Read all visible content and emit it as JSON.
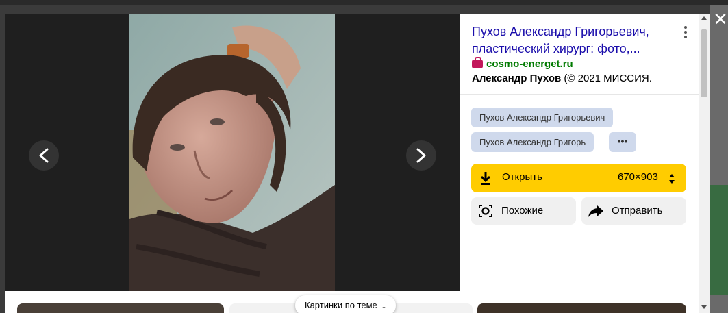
{
  "viewer": {
    "prev_icon": "chevron-left-icon",
    "next_icon": "chevron-right-icon",
    "close_icon": "close-icon"
  },
  "panel": {
    "title": "Пухов Александр Григорьевич, пластический хирург: фото,...",
    "source_icon": "shopping-bag-icon",
    "source_domain": "cosmo-energet.ru",
    "description_bold": "Александр Пухов",
    "description_rest": " (© 2021 МИССИЯ.",
    "tags": [
      "Пухов Александр Григорьевич",
      "Пухов Александр Григорь"
    ],
    "tags_more_label": "•••",
    "open_button": {
      "label": "Открыть",
      "size": "670×903",
      "icon": "download-icon"
    },
    "similar_button": {
      "label": "Похожие",
      "icon": "camera-search-icon"
    },
    "share_button": {
      "label": "Отправить",
      "icon": "share-arrow-icon"
    }
  },
  "related": {
    "label": "Картинки по теме",
    "arrow": "↓"
  },
  "colors": {
    "accent_yellow": "#ffcc00",
    "title_link": "#1a0dab",
    "source_green": "#007a00",
    "tag_bg": "#cfd9ec",
    "viewer_bg": "#1f1f1f"
  }
}
